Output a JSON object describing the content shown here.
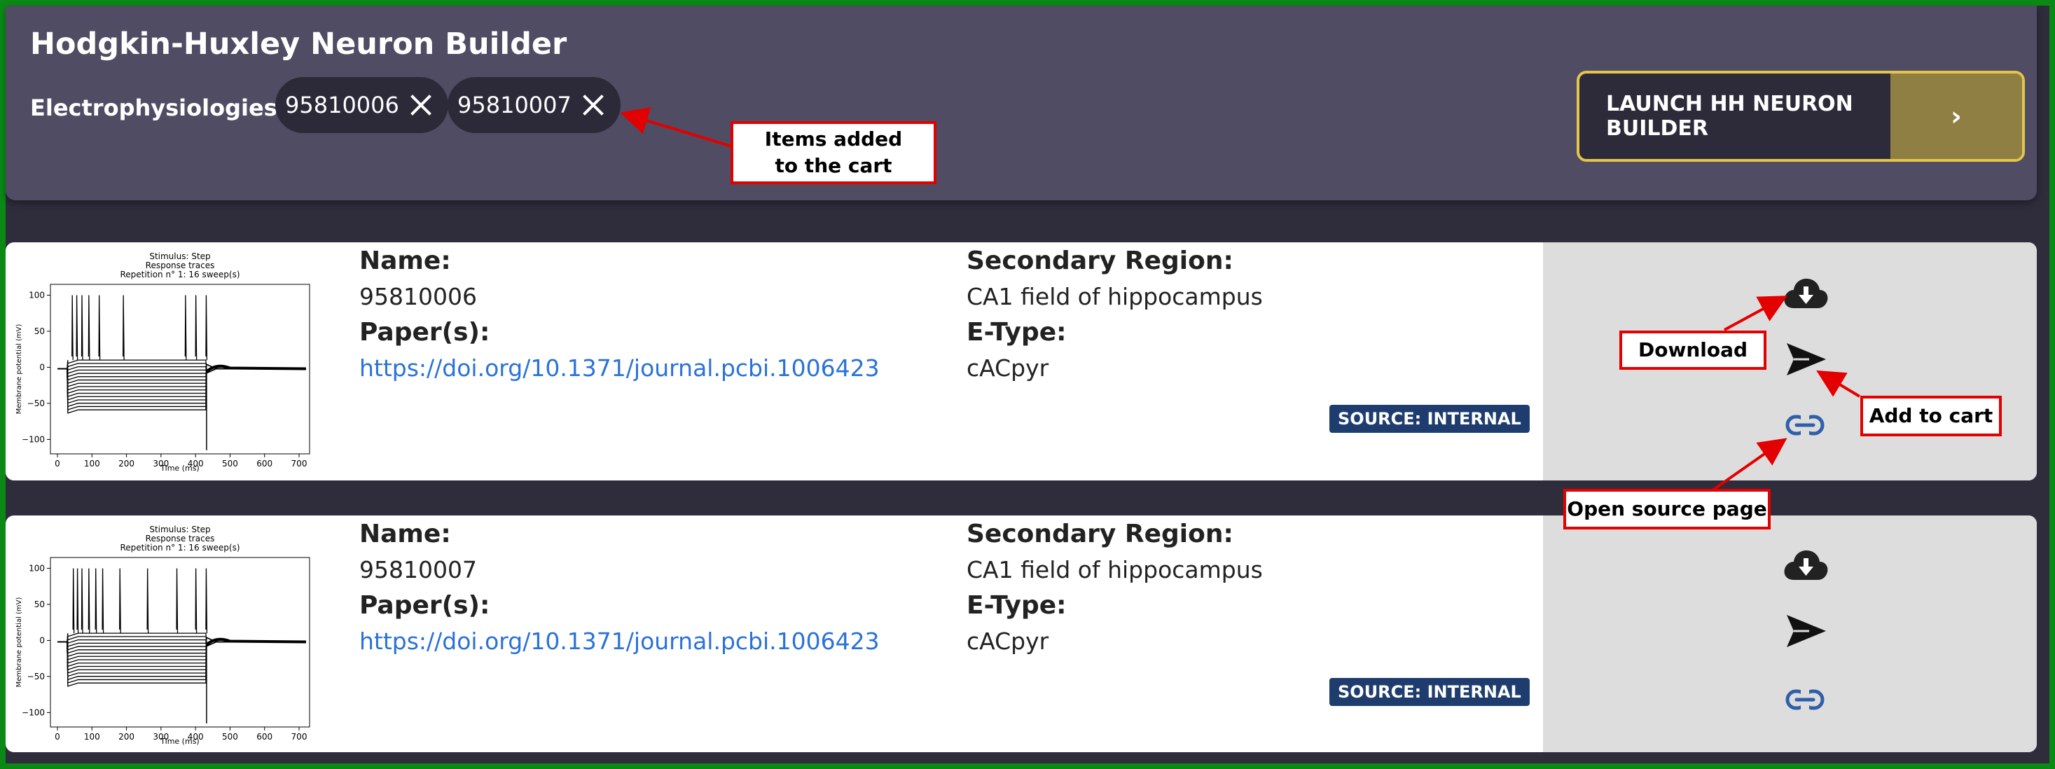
{
  "header": {
    "title": "Hodgkin-Huxley Neuron Builder",
    "ephys_label": "Electrophysiologies:",
    "chips": [
      {
        "label": "95810006"
      },
      {
        "label": "95810007"
      }
    ],
    "launch_label": "LAUNCH HH NEURON BUILDER",
    "launch_arrow": "›"
  },
  "labels": {
    "name": "Name:",
    "papers": "Paper(s):",
    "secondary_region": "Secondary Region:",
    "etype": "E-Type:"
  },
  "cards": [
    {
      "name": "95810006",
      "paper": "https://doi.org/10.1371/journal.pcbi.1006423",
      "secondary_region": "CA1 field of hippocampus",
      "etype": "cACpyr",
      "source": "SOURCE: INTERNAL",
      "plot": {
        "title_lines": [
          "Stimulus: Step",
          "Response traces",
          "Repetition n° 1: 16 sweep(s)"
        ],
        "xlabel": "Time (ms)",
        "ylabel": "Membrane potential (mV)",
        "xticks": [
          "0",
          "100",
          "200",
          "300",
          "400",
          "500",
          "600",
          "700"
        ],
        "yticks": [
          "100",
          "50",
          "0",
          "−50",
          "−100"
        ]
      }
    },
    {
      "name": "95810007",
      "paper": "https://doi.org/10.1371/journal.pcbi.1006423",
      "secondary_region": "CA1 field of hippocampus",
      "etype": "cACpyr",
      "source": "SOURCE: INTERNAL",
      "plot": {
        "title_lines": [
          "Stimulus: Step",
          "Response traces",
          "Repetition n° 1: 16 sweep(s)"
        ],
        "xlabel": "Time (ms)",
        "ylabel": "Membrane potential (mV)",
        "xticks": [
          "0",
          "100",
          "200",
          "300",
          "400",
          "500",
          "600",
          "700"
        ],
        "yticks": [
          "100",
          "50",
          "0",
          "−50",
          "−100"
        ]
      }
    }
  ],
  "annotations": {
    "items_added": [
      "Items added",
      "to the cart"
    ],
    "download": "Download",
    "add_to_cart": "Add to cart",
    "open_source": "Open source page",
    "color": "#e30000"
  },
  "colors": {
    "accent_border": "#e4c44a",
    "link": "#2a72d8",
    "badge": "#1e3d6e",
    "link_icon": "#2f5fa8"
  }
}
